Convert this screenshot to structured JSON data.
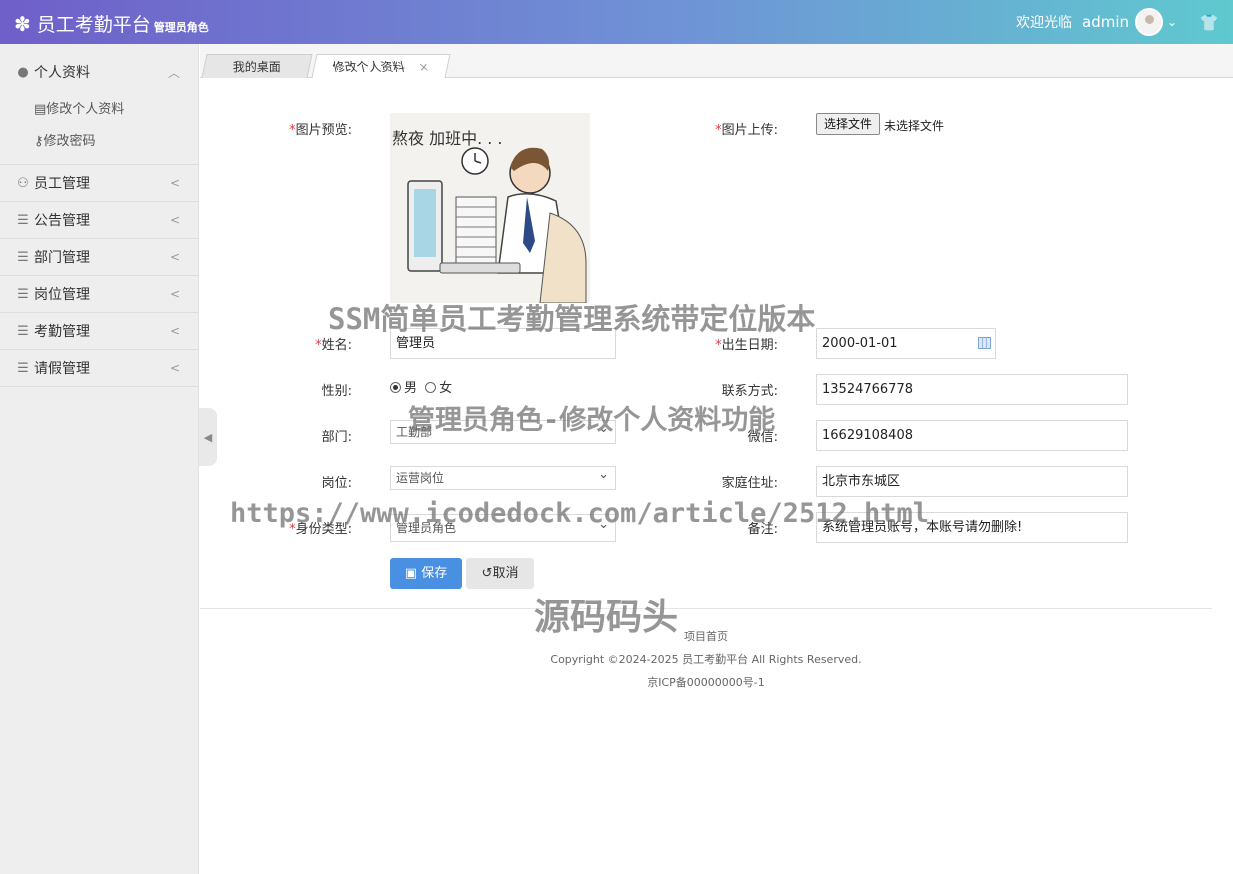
{
  "header": {
    "brand_icon": "gear-flower-icon",
    "title": "员工考勤平台",
    "subtitle": "管理员角色",
    "welcome": "欢迎光临",
    "username": "admin"
  },
  "sidebar": {
    "groups": [
      {
        "label": "个人资料",
        "icon": "person-icon",
        "expanded": true,
        "items": [
          {
            "label": "修改个人资料",
            "icon": "edit-icon"
          },
          {
            "label": "修改密码",
            "icon": "key-icon"
          }
        ]
      },
      {
        "label": "员工管理",
        "icon": "users-icon"
      },
      {
        "label": "公告管理",
        "icon": "list-icon"
      },
      {
        "label": "部门管理",
        "icon": "list-icon"
      },
      {
        "label": "岗位管理",
        "icon": "list-icon"
      },
      {
        "label": "考勤管理",
        "icon": "list-icon"
      },
      {
        "label": "请假管理",
        "icon": "list-icon"
      }
    ]
  },
  "tabs": [
    {
      "label": "我的桌面"
    },
    {
      "label": "修改个人资料",
      "close": "×"
    }
  ],
  "form": {
    "preview_label": "图片预览:",
    "upload_label": "图片上传:",
    "upload_button": "选择文件",
    "upload_status": "未选择文件",
    "preview_text": "熬夜 加班中. . .",
    "name_label": "姓名:",
    "name_value": "管理员",
    "birth_label": "出生日期:",
    "birth_value": "2000-01-01",
    "gender_label": "性别:",
    "gender_male": "男",
    "gender_female": "女",
    "phone_label": "联系方式:",
    "phone_value": "13524766778",
    "dept_label": "部门:",
    "dept_value": "工勤部",
    "wechat_label": "微信:",
    "wechat_value": "16629108408",
    "post_label": "岗位:",
    "post_value": "运营岗位",
    "address_label": "家庭住址:",
    "address_value": "北京市东城区",
    "identity_label": "身份类型:",
    "identity_value": "管理员角色",
    "remark_label": "备注:",
    "remark_value": "系统管理员账号，本账号请勿删除!",
    "save_label": "保存",
    "cancel_label": "取消",
    "required_mark": "*"
  },
  "footer": {
    "home_link": "项目首页",
    "copyright": "Copyright ©2024-2025 员工考勤平台 All Rights Reserved.",
    "icp": "京ICP备00000000号-1"
  },
  "watermarks": {
    "line1": "SSM简单员工考勤管理系统带定位版本",
    "line2": "管理员角色-修改个人资料功能",
    "line3": "https://www.icodedock.com/article/2512.html",
    "line4": "源码码头"
  }
}
